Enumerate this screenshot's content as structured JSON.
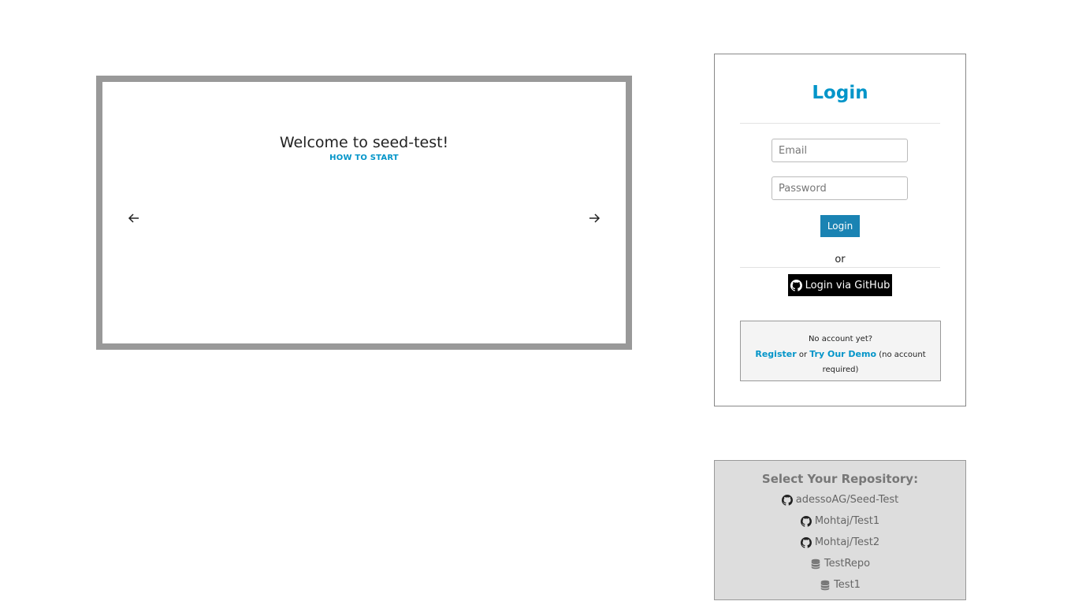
{
  "carousel": {
    "title": "Welcome to seed-test!",
    "subtitle": "HOW TO START",
    "prev_icon": "arrow-left-icon",
    "next_icon": "arrow-right-icon"
  },
  "login": {
    "title": "Login",
    "email_placeholder": "Email",
    "password_placeholder": "Password",
    "login_button": "Login",
    "or_text": "or",
    "github_button": "Login via GitHub",
    "no_account": "No account yet?",
    "register_link": "Register",
    "or_small": "or",
    "demo_link": "Try Our Demo",
    "demo_note": "(no account required)"
  },
  "repositories": {
    "title": "Select Your Repository:",
    "items": [
      {
        "name": "adessoAG/Seed-Test",
        "icon": "github-icon"
      },
      {
        "name": "Mohtaj/Test1",
        "icon": "github-icon"
      },
      {
        "name": "Mohtaj/Test2",
        "icon": "github-icon"
      },
      {
        "name": "TestRepo",
        "icon": "database-icon"
      },
      {
        "name": "Test1",
        "icon": "database-icon"
      }
    ]
  },
  "colors": {
    "accent": "#0395c9",
    "button": "#1a83b3",
    "carousel_border": "#999999",
    "repo_bg": "#dddddd"
  }
}
